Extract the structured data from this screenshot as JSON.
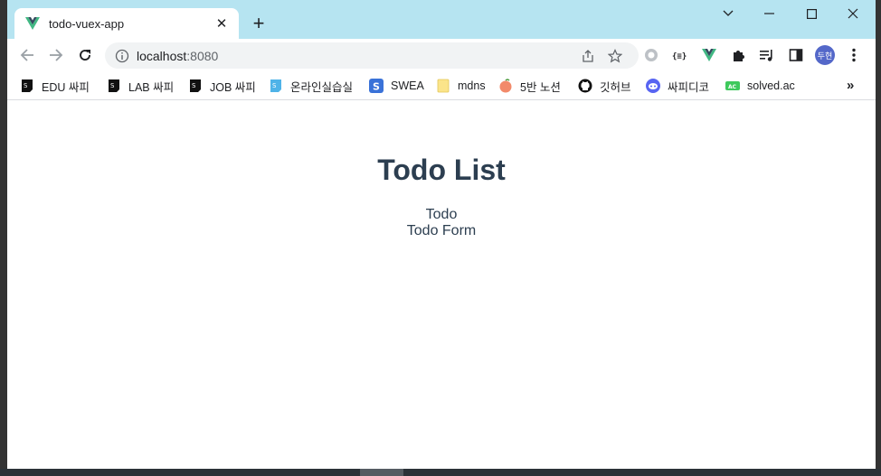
{
  "tab": {
    "title": "todo-vuex-app",
    "close": "✕"
  },
  "newtab": "+",
  "window": {
    "minimize": "─",
    "maximize": "☐",
    "close": "✕",
    "collapse": "⌄"
  },
  "address": {
    "host": "localhost",
    "port": ":8080"
  },
  "bookmarks": [
    {
      "label": "EDU 싸피",
      "icon": "ssafy-icon"
    },
    {
      "label": "LAB 싸피",
      "icon": "ssafy-icon"
    },
    {
      "label": "JOB 싸피",
      "icon": "ssafy-icon"
    },
    {
      "label": "온라인실습실",
      "icon": "ssafy-blue-icon"
    },
    {
      "label": "SWEA",
      "icon": "swea-icon"
    },
    {
      "label": "mdns",
      "icon": "folder-icon"
    },
    {
      "label": "5반 노션",
      "icon": "peach-icon"
    },
    {
      "label": "깃허브",
      "icon": "github-icon"
    },
    {
      "label": "싸피디코",
      "icon": "discord-icon"
    },
    {
      "label": "solved.ac",
      "icon": "solvedac-icon"
    }
  ],
  "bookmarks_more": "»",
  "avatar_text": "두현",
  "page": {
    "title": "Todo List",
    "lines": [
      "Todo",
      "Todo Form"
    ]
  },
  "colors": {
    "tabstrip": "#b6e4f1",
    "heading": "#2c3e50",
    "vue_green": "#41b883",
    "vue_dark": "#35495e"
  }
}
